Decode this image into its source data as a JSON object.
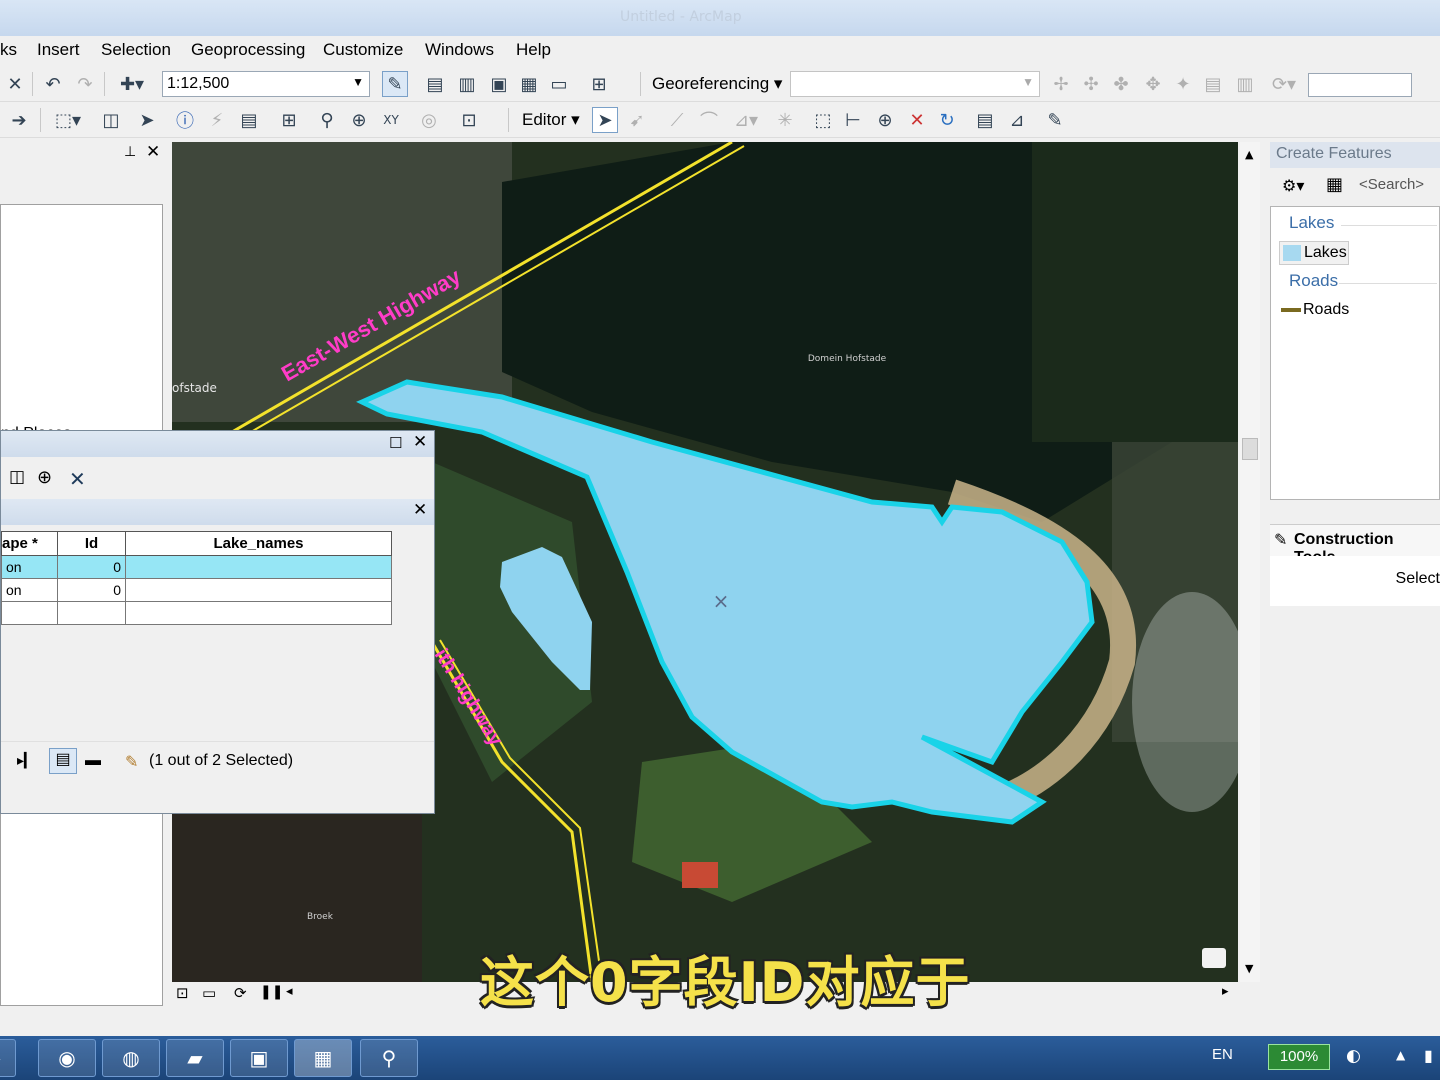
{
  "window": {
    "title": "Untitled - ArcMap"
  },
  "menu": [
    "ks",
    "Insert",
    "Selection",
    "Geoprocessing",
    "Customize",
    "Windows",
    "Help"
  ],
  "toolbar": {
    "scale": "1:12,500",
    "georeferencing_label": "Georeferencing",
    "editor_label": "Editor"
  },
  "toc": {
    "partial_item": "nd Places"
  },
  "map": {
    "labels": {
      "highway_1": "East-West Highway",
      "highway_2": "ith highway",
      "place_1": "Domein Hofstade",
      "place_2": "ofstade",
      "place_3": "Broek"
    }
  },
  "create_features": {
    "title": "Create Features",
    "search_placeholder": "<Search>",
    "groups": [
      {
        "name": "Lakes",
        "item": "Lakes",
        "color": "#a7d9f0"
      },
      {
        "name": "Roads",
        "item": "Roads",
        "color": "#7a6a20"
      }
    ]
  },
  "construction_tools": {
    "title": "Construction Tools",
    "item": "Select"
  },
  "attribute_table": {
    "columns": [
      "ape *",
      "Id",
      "Lake_names"
    ],
    "rows": [
      {
        "shape": "on",
        "id": "0",
        "name": "",
        "selected": true
      },
      {
        "shape": "on",
        "id": "0",
        "name": "",
        "selected": false
      },
      {
        "shape": "",
        "id": "",
        "name": "",
        "selected": false
      }
    ],
    "status": "(1 out of 2 Selected)"
  },
  "subtitle": "这个0字段ID对应于",
  "taskbar": {
    "language": "EN",
    "battery": "100%"
  },
  "colors": {
    "lake_fill": "#8fd3ef",
    "lake_outline": "#19d3e8",
    "selection_row": "#96e6f5",
    "highway_label": "#ff3cc8"
  }
}
